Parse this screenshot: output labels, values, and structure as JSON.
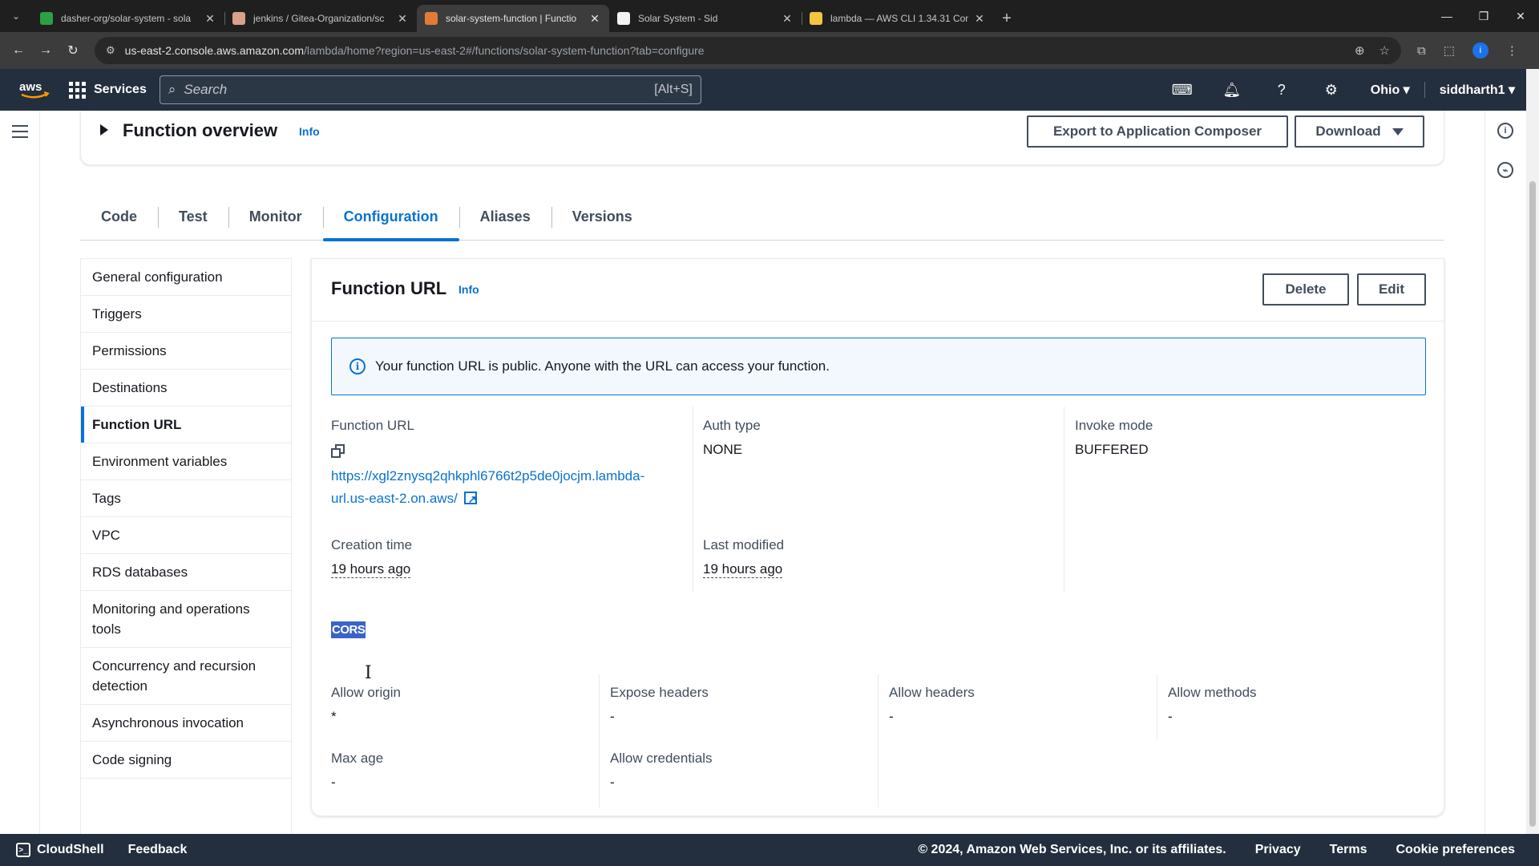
{
  "browser": {
    "tabs": [
      {
        "title": "dasher-org/solar-system - sola",
        "fav_color": "#2ea043"
      },
      {
        "title": "jenkins / Gitea-Organization/sc",
        "fav_color": "#d9a08a"
      },
      {
        "title": "solar-system-function | Functio",
        "fav_color": "#e07b39"
      },
      {
        "title": "Solar System - Sid",
        "fav_color": "#f2f2f2"
      },
      {
        "title": "lambda — AWS CLI 1.34.31 Con",
        "fav_color": "#f5c542"
      }
    ],
    "url_host": "us-east-2.console.aws.amazon.com",
    "url_path": "/lambda/home?region=us-east-2#/functions/solar-system-function?tab=configure",
    "profile_initial": "i"
  },
  "aws_nav": {
    "services_label": "Services",
    "search_placeholder": "Search",
    "search_shortcut": "[Alt+S]",
    "region": "Ohio",
    "user": "siddharth1"
  },
  "overview": {
    "title": "Function overview",
    "info": "Info",
    "export_button": "Export to Application Composer",
    "download_button": "Download"
  },
  "tabs": [
    {
      "label": "Code"
    },
    {
      "label": "Test"
    },
    {
      "label": "Monitor"
    },
    {
      "label": "Configuration"
    },
    {
      "label": "Aliases"
    },
    {
      "label": "Versions"
    }
  ],
  "sidenav": [
    {
      "label": "General configuration"
    },
    {
      "label": "Triggers"
    },
    {
      "label": "Permissions"
    },
    {
      "label": "Destinations"
    },
    {
      "label": "Function URL"
    },
    {
      "label": "Environment variables"
    },
    {
      "label": "Tags"
    },
    {
      "label": "VPC"
    },
    {
      "label": "RDS databases"
    },
    {
      "label": "Monitoring and operations tools"
    },
    {
      "label": "Concurrency and recursion detection"
    },
    {
      "label": "Asynchronous invocation"
    },
    {
      "label": "Code signing"
    }
  ],
  "panel": {
    "title": "Function URL",
    "info": "Info",
    "delete_button": "Delete",
    "edit_button": "Edit",
    "alert_text": "Your function URL is public. Anyone with the URL can access your function.",
    "function_url_label": "Function URL",
    "function_url_value": "https://xgl2znysq2qhkphl6766t2p5de0jocjm.lambda-url.us-east-2.on.aws/",
    "auth_type_label": "Auth type",
    "auth_type_value": "NONE",
    "invoke_mode_label": "Invoke mode",
    "invoke_mode_value": "BUFFERED",
    "creation_time_label": "Creation time",
    "creation_time_value": "19 hours ago",
    "last_modified_label": "Last modified",
    "last_modified_value": "19 hours ago",
    "cors_heading": "CORS",
    "allow_origin_label": "Allow origin",
    "allow_origin_value": "*",
    "expose_headers_label": "Expose headers",
    "expose_headers_value": "-",
    "allow_headers_label": "Allow headers",
    "allow_headers_value": "-",
    "allow_methods_label": "Allow methods",
    "allow_methods_value": "-",
    "max_age_label": "Max age",
    "max_age_value": "-",
    "allow_credentials_label": "Allow credentials",
    "allow_credentials_value": "-"
  },
  "footer": {
    "cloudshell": "CloudShell",
    "feedback": "Feedback",
    "copyright": "© 2024, Amazon Web Services, Inc. or its affiliates.",
    "privacy": "Privacy",
    "terms": "Terms",
    "cookie": "Cookie preferences"
  },
  "colors": {
    "accent": "#0972d3",
    "nav_bg": "#232f3e",
    "selection": "#3a63c8"
  }
}
